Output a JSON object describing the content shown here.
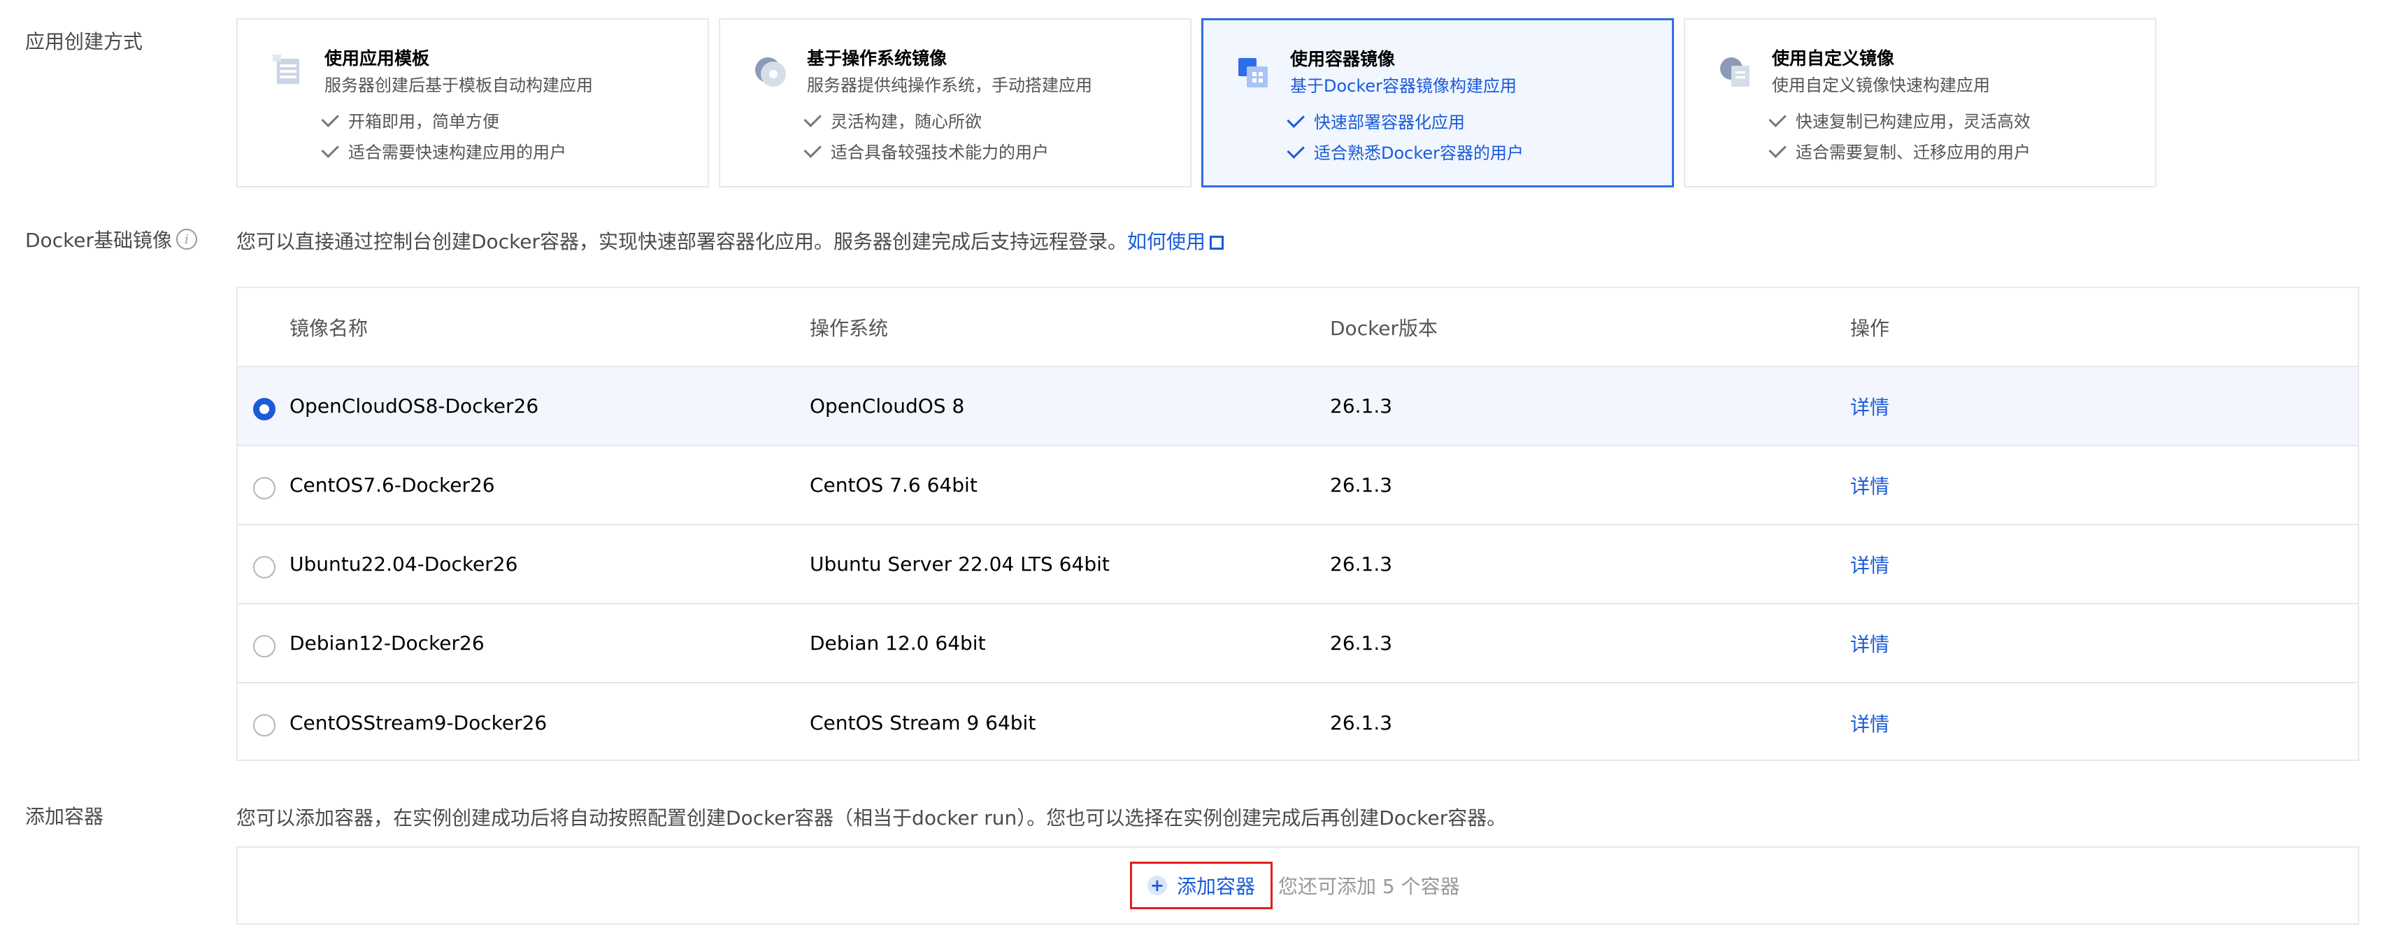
{
  "method": {
    "label": "应用创建方式",
    "cards": [
      {
        "title": "使用应用模板",
        "subtitle": "服务器创建后基于模板自动构建应用",
        "features": [
          "开箱即用，简单方便",
          "适合需要快速构建应用的用户"
        ],
        "icon": "template-stack-icon",
        "selected": false
      },
      {
        "title": "基于操作系统镜像",
        "subtitle": "服务器提供纯操作系统，手动搭建应用",
        "features": [
          "灵活构建，随心所欲",
          "适合具备较强技术能力的用户"
        ],
        "icon": "os-disc-icon",
        "selected": false
      },
      {
        "title": "使用容器镜像",
        "subtitle": "基于Docker容器镜像构建应用",
        "features": [
          "快速部署容器化应用",
          "适合熟悉Docker容器的用户"
        ],
        "icon": "container-image-icon",
        "selected": true
      },
      {
        "title": "使用自定义镜像",
        "subtitle": "使用自定义镜像快速构建应用",
        "features": [
          "快速复制已构建应用，灵活高效",
          "适合需要复制、迁移应用的用户"
        ],
        "icon": "custom-image-icon",
        "selected": false
      }
    ]
  },
  "docker": {
    "label": "Docker基础镜像",
    "info_icon": "info-icon",
    "description": "您可以直接通过控制台创建Docker容器，实现快速部署容器化应用。服务器创建完成后支持远程登录。",
    "help_link": "如何使用",
    "columns": [
      "镜像名称",
      "操作系统",
      "Docker版本",
      "操作"
    ],
    "rows": [
      {
        "name": "OpenCloudOS8-Docker26",
        "os": "OpenCloudOS 8",
        "version": "26.1.3",
        "action": "详情",
        "selected": true
      },
      {
        "name": "CentOS7.6-Docker26",
        "os": "CentOS 7.6 64bit",
        "version": "26.1.3",
        "action": "详情",
        "selected": false
      },
      {
        "name": "Ubuntu22.04-Docker26",
        "os": "Ubuntu Server 22.04 LTS 64bit",
        "version": "26.1.3",
        "action": "详情",
        "selected": false
      },
      {
        "name": "Debian12-Docker26",
        "os": "Debian 12.0 64bit",
        "version": "26.1.3",
        "action": "详情",
        "selected": false
      },
      {
        "name": "CentOSStream9-Docker26",
        "os": "CentOS Stream 9 64bit",
        "version": "26.1.3",
        "action": "详情",
        "selected": false
      }
    ]
  },
  "container": {
    "label": "添加容器",
    "description": "您可以添加容器，在实例创建成功后将自动按照配置创建Docker容器（相当于docker run）。您也可以选择在实例创建完成后再创建Docker容器。",
    "add_button": "添加容器",
    "hint": "您还可添加 5 个容器"
  },
  "colors": {
    "accent": "#1b5bd8",
    "highlight_border": "#e02020",
    "selected_bg": "#f1f6ff"
  }
}
